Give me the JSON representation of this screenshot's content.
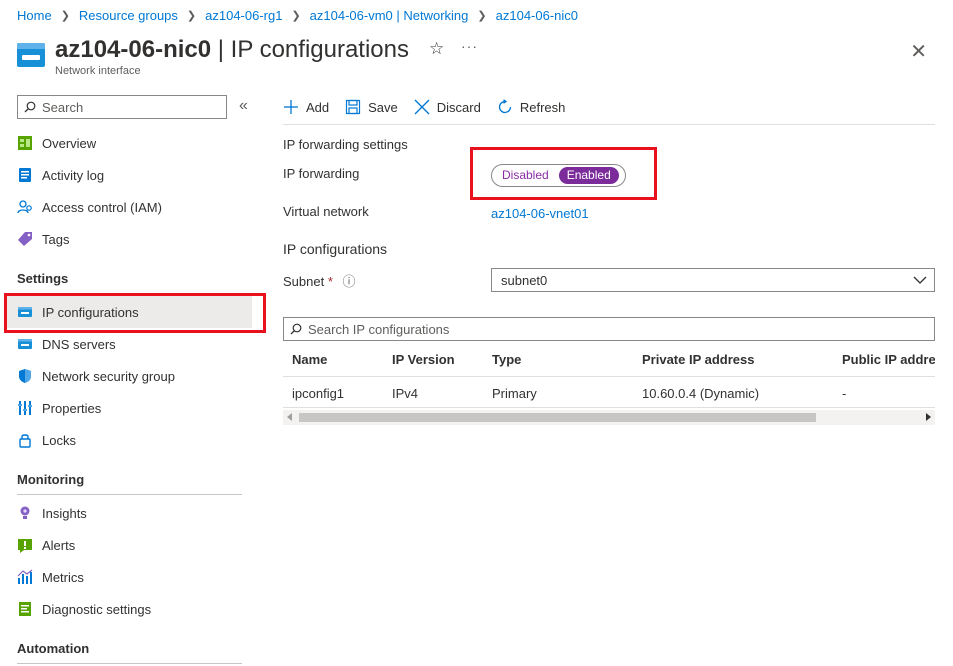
{
  "breadcrumb": [
    "Home",
    "Resource groups",
    "az104-06-rg1",
    "az104-06-vm0 | Networking",
    "az104-06-nic0"
  ],
  "header": {
    "title_bold": "az104-06-nic0",
    "title_rest": " | IP configurations",
    "subtitle": "Network interface",
    "star_icon": "☆",
    "more_icon": "···",
    "close_icon": "✕"
  },
  "sidebar": {
    "search_placeholder": "Search",
    "collapse_icon": "«",
    "items": [
      {
        "label": "Overview",
        "icon": "overview-icon"
      },
      {
        "label": "Activity log",
        "icon": "activity-log-icon"
      },
      {
        "label": "Access control (IAM)",
        "icon": "iam-icon"
      },
      {
        "label": "Tags",
        "icon": "tag-icon"
      }
    ],
    "settings_header": "Settings",
    "settings_items": [
      {
        "label": "IP configurations",
        "icon": "ip-config-icon",
        "active": true
      },
      {
        "label": "DNS servers",
        "icon": "dns-icon"
      },
      {
        "label": "Network security group",
        "icon": "shield-icon"
      },
      {
        "label": "Properties",
        "icon": "properties-icon"
      },
      {
        "label": "Locks",
        "icon": "lock-icon"
      }
    ],
    "monitoring_header": "Monitoring",
    "monitoring_items": [
      {
        "label": "Insights",
        "icon": "insights-icon"
      },
      {
        "label": "Alerts",
        "icon": "alerts-icon"
      },
      {
        "label": "Metrics",
        "icon": "metrics-icon"
      },
      {
        "label": "Diagnostic settings",
        "icon": "diagnostic-icon"
      }
    ],
    "automation_header": "Automation"
  },
  "toolbar": {
    "add": "Add",
    "save": "Save",
    "discard": "Discard",
    "refresh": "Refresh"
  },
  "form": {
    "ip_forwarding_settings_title": "IP forwarding settings",
    "ip_forwarding_label": "IP forwarding",
    "toggle_disabled": "Disabled",
    "toggle_enabled": "Enabled",
    "toggle_value": "Enabled",
    "virtual_network_label": "Virtual network",
    "virtual_network_value": "az104-06-vnet01",
    "ip_configurations_title": "IP configurations",
    "subnet_label": "Subnet",
    "subnet_required": "*",
    "subnet_info": "ⓘ",
    "subnet_value": "subnet0"
  },
  "ip_table": {
    "search_placeholder": "Search IP configurations",
    "columns": [
      "Name",
      "IP Version",
      "Type",
      "Private IP address",
      "Public IP address"
    ],
    "rows": [
      [
        "ipconfig1",
        "IPv4",
        "Primary",
        "10.60.0.4 (Dynamic)",
        "-"
      ]
    ]
  },
  "colors": {
    "accent": "#0078d4",
    "toggle_on": "#7b2c9a",
    "highlight": "#e8111d"
  }
}
